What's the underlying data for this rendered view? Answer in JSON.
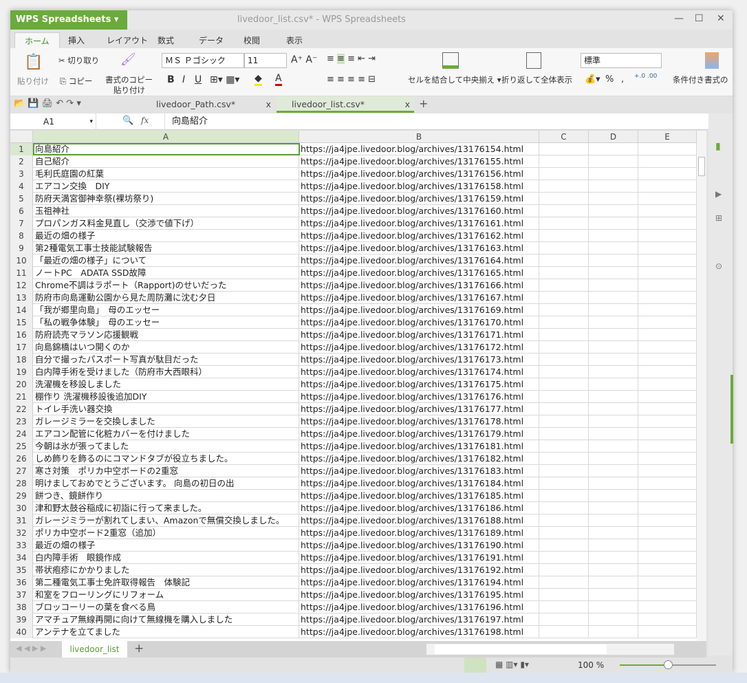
{
  "app": {
    "name": "WPS Spreadsheets",
    "title": "livedoor_list.csv* - WPS Spreadsheets"
  },
  "ribbon_tabs": [
    "ホーム",
    "挿入",
    "レイアウト",
    "数式",
    "データ",
    "校閲",
    "表示"
  ],
  "ribbon": {
    "paste": "貼り付け",
    "cut": "切り取り",
    "copy": "コピー",
    "format_painter_1": "書式のコピー",
    "format_painter_2": "貼り付け",
    "font": "ＭＳ Ｐゴシック",
    "size": "11",
    "merge": "セルを結合して中央揃え",
    "wrap": "折り返して全体表示",
    "number_format": "標準",
    "cond_format": "条件付き書式の",
    "percent": "%",
    "comma": ","
  },
  "doc_tabs": [
    {
      "label": "livedoor_Path.csv*"
    },
    {
      "label": "livedoor_list.csv*"
    }
  ],
  "formula": {
    "cell_ref": "A1",
    "fx": "fx",
    "value": "向島紹介"
  },
  "columns": [
    "A",
    "B",
    "C",
    "D",
    "E"
  ],
  "rows": [
    [
      "向島紹介",
      "https://ja4jpe.livedoor.blog/archives/13176154.html"
    ],
    [
      "自己紹介",
      "https://ja4jpe.livedoor.blog/archives/13176155.html"
    ],
    [
      "毛利氏庭園の紅葉",
      "https://ja4jpe.livedoor.blog/archives/13176156.html"
    ],
    [
      "エアコン交換　DIY",
      "https://ja4jpe.livedoor.blog/archives/13176158.html"
    ],
    [
      "防府天満宮御神幸祭(裸坊祭り)",
      "https://ja4jpe.livedoor.blog/archives/13176159.html"
    ],
    [
      "玉祖神社",
      "https://ja4jpe.livedoor.blog/archives/13176160.html"
    ],
    [
      "プロパンガス料金見直し（交渉で値下げ）",
      "https://ja4jpe.livedoor.blog/archives/13176161.html"
    ],
    [
      "最近の畑の様子",
      "https://ja4jpe.livedoor.blog/archives/13176162.html"
    ],
    [
      "第2種電気工事士技能試験報告",
      "https://ja4jpe.livedoor.blog/archives/13176163.html"
    ],
    [
      "「最近の畑の様子」について",
      "https://ja4jpe.livedoor.blog/archives/13176164.html"
    ],
    [
      "ノートPC　ADATA SSD故障",
      "https://ja4jpe.livedoor.blog/archives/13176165.html"
    ],
    [
      "Chrome不調はラポート（Rapport)のせいだった",
      "https://ja4jpe.livedoor.blog/archives/13176166.html"
    ],
    [
      "防府市向島運動公園から見た周防灘に沈む夕日",
      "https://ja4jpe.livedoor.blog/archives/13176167.html"
    ],
    [
      "「我が郷里向島」　母のエッセー",
      "https://ja4jpe.livedoor.blog/archives/13176169.html"
    ],
    [
      "「私の戦争体験」　母のエッセー",
      "https://ja4jpe.livedoor.blog/archives/13176170.html"
    ],
    [
      "防府読売マラソン応援観戦",
      "https://ja4jpe.livedoor.blog/archives/13176171.html"
    ],
    [
      "向島錦橋はいつ開くのか",
      "https://ja4jpe.livedoor.blog/archives/13176172.html"
    ],
    [
      "自分で撮ったパスポート写真が駄目だった",
      "https://ja4jpe.livedoor.blog/archives/13176173.html"
    ],
    [
      "白内障手術を受けました（防府市大西眼科）",
      "https://ja4jpe.livedoor.blog/archives/13176174.html"
    ],
    [
      "洗濯機を移設しました",
      "https://ja4jpe.livedoor.blog/archives/13176175.html"
    ],
    [
      "棚作り 洗濯機移設後追加DIY",
      "https://ja4jpe.livedoor.blog/archives/13176176.html"
    ],
    [
      "トイレ手洗い器交換",
      "https://ja4jpe.livedoor.blog/archives/13176177.html"
    ],
    [
      "ガレージミラーを交換しました",
      "https://ja4jpe.livedoor.blog/archives/13176178.html"
    ],
    [
      "エアコン配管に化粧カバーを付けました",
      "https://ja4jpe.livedoor.blog/archives/13176179.html"
    ],
    [
      "今朝は氷が張ってました",
      "https://ja4jpe.livedoor.blog/archives/13176181.html"
    ],
    [
      "しめ飾りを飾るのにコマンドタブが役立ちました。",
      "https://ja4jpe.livedoor.blog/archives/13176182.html"
    ],
    [
      "寒さ対策　ポリカ中空ボードの2重窓",
      "https://ja4jpe.livedoor.blog/archives/13176183.html"
    ],
    [
      "明けましておめでとうございます。 向島の初日の出",
      "https://ja4jpe.livedoor.blog/archives/13176184.html"
    ],
    [
      "餅つき、鏡餅作り",
      "https://ja4jpe.livedoor.blog/archives/13176185.html"
    ],
    [
      "津和野太鼓谷稲成に初詣に行って来ました。",
      "https://ja4jpe.livedoor.blog/archives/13176186.html"
    ],
    [
      "ガレージミラーが割れてしまい、Amazonで無償交換しました。",
      "https://ja4jpe.livedoor.blog/archives/13176188.html"
    ],
    [
      "ポリカ中空ボード2重窓（追加）",
      "https://ja4jpe.livedoor.blog/archives/13176189.html"
    ],
    [
      "最近の畑の様子",
      "https://ja4jpe.livedoor.blog/archives/13176190.html"
    ],
    [
      "白内障手術　眼鏡作成",
      "https://ja4jpe.livedoor.blog/archives/13176191.html"
    ],
    [
      "帯状疱疹にかかりました",
      "https://ja4jpe.livedoor.blog/archives/13176192.html"
    ],
    [
      "第二種電気工事士免許取得報告　体験記",
      "https://ja4jpe.livedoor.blog/archives/13176194.html"
    ],
    [
      "和室をフローリングにリフォーム",
      "https://ja4jpe.livedoor.blog/archives/13176195.html"
    ],
    [
      "ブロッコーリーの葉を食べる鳥",
      "https://ja4jpe.livedoor.blog/archives/13176196.html"
    ],
    [
      "アマチュア無線再開に向けて無線機を購入しました",
      "https://ja4jpe.livedoor.blog/archives/13176197.html"
    ],
    [
      "アンテナを立てました",
      "https://ja4jpe.livedoor.blog/archives/13176198.html"
    ]
  ],
  "sheet_tabs": [
    "livedoor_list"
  ],
  "status": {
    "zoom": "100 %",
    "zoom_fraction": 0.5
  },
  "colors": {
    "accent": "#6aab3b"
  }
}
